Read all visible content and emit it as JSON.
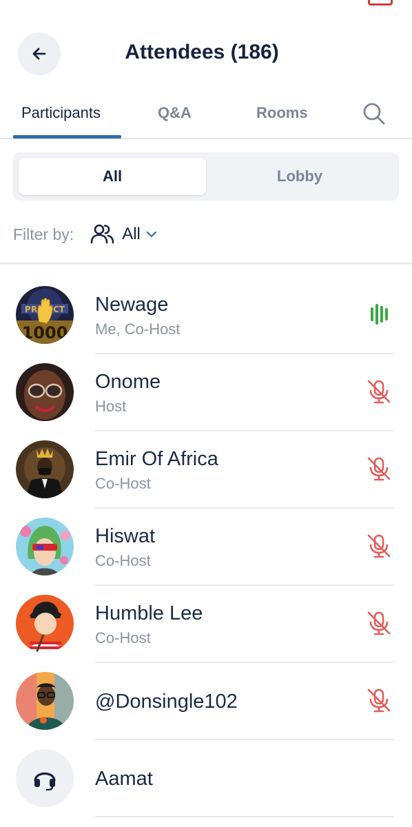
{
  "header": {
    "title": "Attendees (186)"
  },
  "tabs": [
    {
      "label": "Participants",
      "active": true
    },
    {
      "label": "Q&A",
      "active": false
    },
    {
      "label": "Rooms",
      "active": false
    }
  ],
  "segment": {
    "all_label": "All",
    "lobby_label": "Lobby"
  },
  "filter": {
    "label": "Filter by:",
    "value": "All"
  },
  "participants": [
    {
      "name": "Newage",
      "role": "Me, Co-Host",
      "audio": "speaking",
      "avatar": "project-1000-logo-with-raised-hand"
    },
    {
      "name": "Onome",
      "role": "Host",
      "audio": "muted",
      "avatar": "woman-with-glasses"
    },
    {
      "name": "Emir Of Africa",
      "role": "Co-Host",
      "audio": "muted",
      "avatar": "man-with-crown-in-suit"
    },
    {
      "name": "Hiswat",
      "role": "Co-Host",
      "audio": "muted",
      "avatar": "green-hair-character-with-visor"
    },
    {
      "name": "Humble Lee",
      "role": "Co-Host",
      "audio": "muted",
      "avatar": "cartoon-boy-striped-shirt"
    },
    {
      "name": "@Donsingle102",
      "role": "",
      "audio": "muted",
      "avatar": "man-with-glasses-colorful"
    },
    {
      "name": "Aamat",
      "role": "",
      "audio": "none",
      "avatar": "headset-icon"
    }
  ],
  "colors": {
    "accent": "#2f6fab",
    "speaking": "#3aa845",
    "muted": "#e45b5b",
    "title": "#16233f"
  }
}
